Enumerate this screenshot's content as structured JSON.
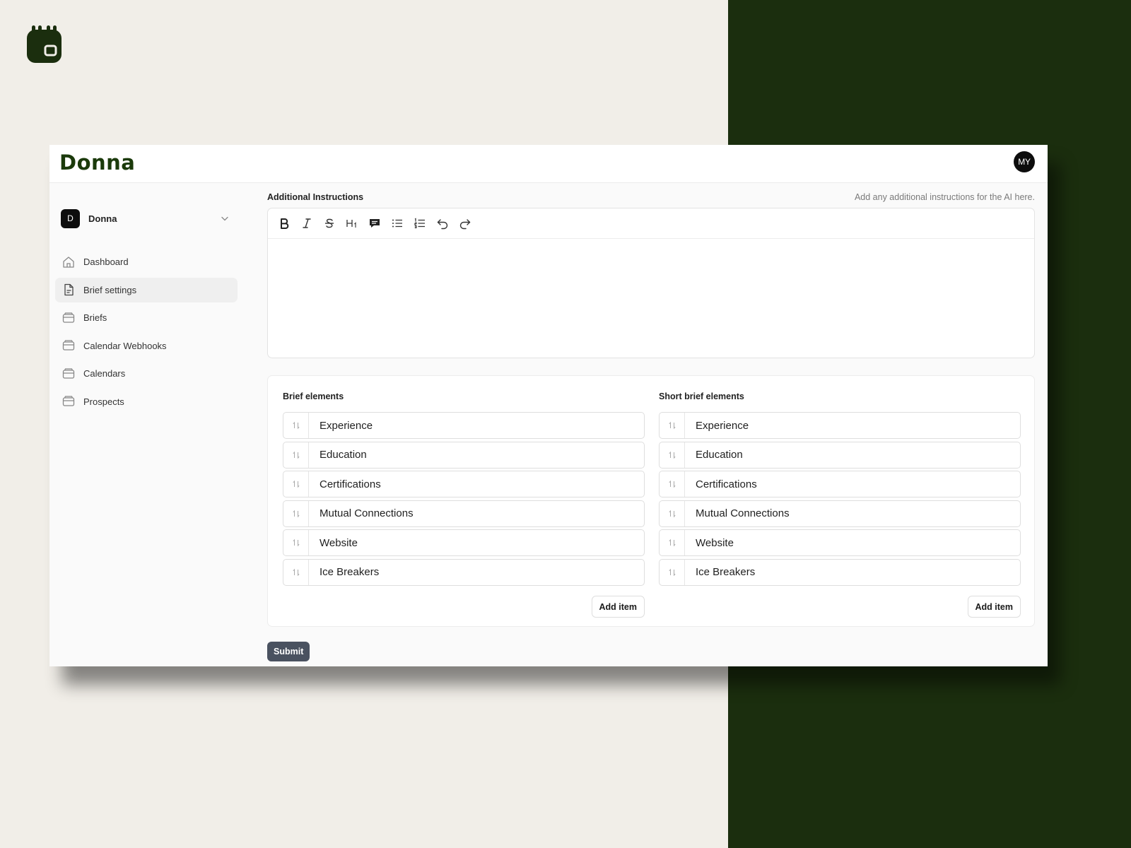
{
  "app": {
    "brand": "Donna",
    "user_initials": "MY"
  },
  "sidebar": {
    "workspace": {
      "initial": "D",
      "name": "Donna"
    },
    "items": [
      {
        "label": "Dashboard",
        "icon": "home-icon",
        "active": false
      },
      {
        "label": "Brief settings",
        "icon": "document-icon",
        "active": true
      },
      {
        "label": "Briefs",
        "icon": "inbox-icon",
        "active": false
      },
      {
        "label": "Calendar Webhooks",
        "icon": "inbox-icon",
        "active": false
      },
      {
        "label": "Calendars",
        "icon": "inbox-icon",
        "active": false
      },
      {
        "label": "Prospects",
        "icon": "inbox-icon",
        "active": false
      }
    ]
  },
  "instructions": {
    "label": "Additional Instructions",
    "hint": "Add any additional instructions for the AI here.",
    "value": "",
    "toolbar": [
      "bold-icon",
      "italic-icon",
      "strikethrough-icon",
      "heading-icon",
      "comment-icon",
      "bullet-list-icon",
      "ordered-list-icon",
      "undo-icon",
      "redo-icon"
    ]
  },
  "brief_elements": {
    "title": "Brief elements",
    "items": [
      "Experience",
      "Education",
      "Certifications",
      "Mutual Connections",
      "Website",
      "Ice Breakers"
    ],
    "add_label": "Add item"
  },
  "short_brief_elements": {
    "title": "Short brief elements",
    "items": [
      "Experience",
      "Education",
      "Certifications",
      "Mutual Connections",
      "Website",
      "Ice Breakers"
    ],
    "add_label": "Add item"
  },
  "submit_label": "Submit",
  "colors": {
    "brand_green": "#1b3a0b",
    "dark_panel": "#1b2e0e",
    "page_bg": "#f1eee8",
    "submit_bg": "#4a5260"
  }
}
